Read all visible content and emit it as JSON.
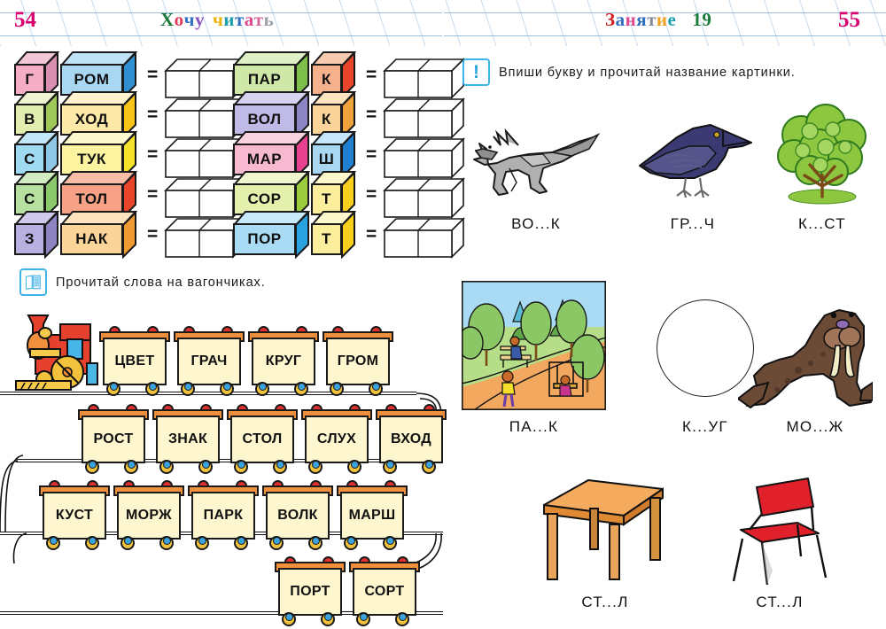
{
  "page": {
    "left_page_number": "54",
    "right_page_number": "55",
    "left_title_letters": [
      {
        "ch": "Х",
        "color": "#1b7a3a"
      },
      {
        "ch": "о",
        "color": "#e03a5a"
      },
      {
        "ch": "ч",
        "color": "#2f6fc0"
      },
      {
        "ch": "у",
        "color": "#8a4fbe"
      },
      {
        "ch": " ",
        "color": "#000000"
      },
      {
        "ch": "ч",
        "color": "#e8b400"
      },
      {
        "ch": "и",
        "color": "#1a9fa8"
      },
      {
        "ch": "т",
        "color": "#2f6fc0"
      },
      {
        "ch": "а",
        "color": "#e0478f"
      },
      {
        "ch": "т",
        "color": "#d4679a"
      },
      {
        "ch": "ь",
        "color": "#9aa0a6"
      }
    ],
    "right_title_letters": [
      {
        "ch": "З",
        "color": "#d22020"
      },
      {
        "ch": "а",
        "color": "#2f6fc0"
      },
      {
        "ch": "н",
        "color": "#e0478f"
      },
      {
        "ch": "я",
        "color": "#2f6fc0"
      },
      {
        "ch": "т",
        "color": "#7f8a93"
      },
      {
        "ch": "и",
        "color": "#f0a020"
      },
      {
        "ch": "е",
        "color": "#1a9fa8"
      },
      {
        "ch": " ",
        "color": "#000000"
      },
      {
        "ch": " ",
        "color": "#000000"
      },
      {
        "ch": "1",
        "color": "#1b7a3a"
      },
      {
        "ch": "9",
        "color": "#1b7a3a"
      }
    ]
  },
  "exercise_blocks": {
    "column_left": [
      {
        "a": "Г",
        "a_front": "#f6aec7",
        "a_top": "#f2c6d6",
        "a_side": "#d98fb0",
        "b": "РОМ",
        "b_front": "#a9d7f2",
        "b_top": "#bfe2f7",
        "b_side": "#2f8fd0",
        "result_cells": 2
      },
      {
        "a": "В",
        "a_front": "#e2eeb0",
        "a_top": "#edf4cf",
        "a_side": "#9ec85a",
        "b": "ХОД",
        "b_front": "#fde9a8",
        "b_top": "#fef3ce",
        "b_side": "#f8c419",
        "result_cells": 2
      },
      {
        "a": "С",
        "a_front": "#9fd9f2",
        "a_top": "#c3e7f8",
        "a_side": "#8fc8e6",
        "b": "ТУК",
        "b_front": "#fbf3a0",
        "b_top": "#fdf8cd",
        "b_side": "#f6e22a",
        "result_cells": 2
      },
      {
        "a": "С",
        "a_front": "#b6e0a0",
        "a_top": "#d2ecc2",
        "a_side": "#8cc86c",
        "b": "ТОЛ",
        "b_front": "#f7a186",
        "b_top": "#f8bda6",
        "b_side": "#e8452a",
        "result_cells": 2
      },
      {
        "a": "З",
        "a_front": "#b8b0e0",
        "a_top": "#cfc9ec",
        "a_side": "#8e84c2",
        "b": "НАК",
        "b_front": "#fbd49a",
        "b_top": "#fde4bf",
        "b_side": "#f09a34",
        "result_cells": 2
      }
    ],
    "column_right": [
      {
        "a": "ПАР",
        "a_front": "#cfe8a8",
        "a_top": "#e0f0c6",
        "a_side": "#7dbf4a",
        "b": "К",
        "b_front": "#f5b08c",
        "b_top": "#f8cbb0",
        "b_side": "#e8452a",
        "result_cells": 2
      },
      {
        "a": "ВОЛ",
        "a_front": "#c0bbe6",
        "a_top": "#d6d2ef",
        "a_side": "#8d86c4",
        "b": "К",
        "b_front": "#fbd49a",
        "b_top": "#fde4bf",
        "b_side": "#f0a23a",
        "result_cells": 2
      },
      {
        "a": "МАР",
        "a_front": "#f6b9cf",
        "a_top": "#f9d2e0",
        "a_side": "#e8428e",
        "b": "Ш",
        "b_front": "#a9d7f2",
        "b_top": "#c6e6f9",
        "b_side": "#1f7fd0",
        "result_cells": 2
      },
      {
        "a": "СОР",
        "a_front": "#e4f0ae",
        "a_top": "#eff6cd",
        "a_side": "#9ccb3e",
        "b": "Т",
        "b_front": "#fbef9e",
        "b_top": "#fdf7cc",
        "b_side": "#f8cf1c",
        "result_cells": 2
      },
      {
        "a": "ПОР",
        "a_front": "#a9dcf4",
        "a_top": "#c7e9f9",
        "a_side": "#29a3e0",
        "b": "Т",
        "b_front": "#fbef9e",
        "b_top": "#fdf7cc",
        "b_side": "#f8d01c",
        "result_cells": 2
      }
    ]
  },
  "train_task": {
    "instruction": "Прочитай слова на вагончиках.",
    "icon": "book-icon",
    "rows": [
      {
        "words": [
          "ЦВЕТ",
          "ГРАЧ",
          "КРУГ",
          "ГРОМ"
        ]
      },
      {
        "words": [
          "РОСТ",
          "ЗНАК",
          "СТОЛ",
          "СЛУХ",
          "ВХОД"
        ]
      },
      {
        "words": [
          "КУСТ",
          "МОРЖ",
          "ПАРК",
          "ВОЛК",
          "МАРШ"
        ]
      },
      {
        "words": [
          "ПОРТ",
          "СОРТ"
        ]
      }
    ]
  },
  "picture_task": {
    "instruction": "Впиши букву и прочитай название картинки.",
    "icon": "exclamation-icon",
    "items": [
      {
        "picture": "wolf",
        "caption": "ВО...К"
      },
      {
        "picture": "rook",
        "caption": "ГР...Ч"
      },
      {
        "picture": "bush",
        "caption": "К...СТ"
      },
      {
        "picture": "park",
        "caption": "ПА...К"
      },
      {
        "picture": "circle",
        "caption": "К...УГ"
      },
      {
        "picture": "walrus",
        "caption": "МО...Ж"
      },
      {
        "picture": "table",
        "caption": "СТ...Л"
      },
      {
        "picture": "chair",
        "caption": "СТ...Л"
      }
    ]
  }
}
